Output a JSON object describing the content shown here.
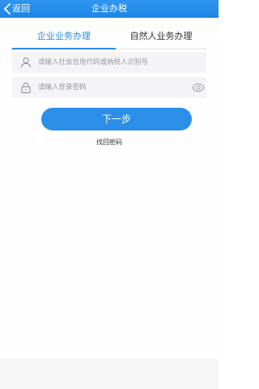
{
  "header": {
    "back_label": "返回",
    "title": "企业办税"
  },
  "tabs": [
    {
      "label": "企业业务办理",
      "active": true
    },
    {
      "label": "自然人业务办理",
      "active": false
    }
  ],
  "form": {
    "account": {
      "placeholder": "请输入社会信用代码或纳税人识别号",
      "value": "",
      "icon": "user-icon"
    },
    "password": {
      "placeholder": "请输入登录密码",
      "value": "",
      "icon": "lock-icon",
      "toggle_icon": "eye-icon"
    },
    "next_label": "下一步",
    "forgot_label": "找回密码"
  },
  "colors": {
    "accent": "#2a8be5",
    "header_bg": "#1d86e6"
  }
}
